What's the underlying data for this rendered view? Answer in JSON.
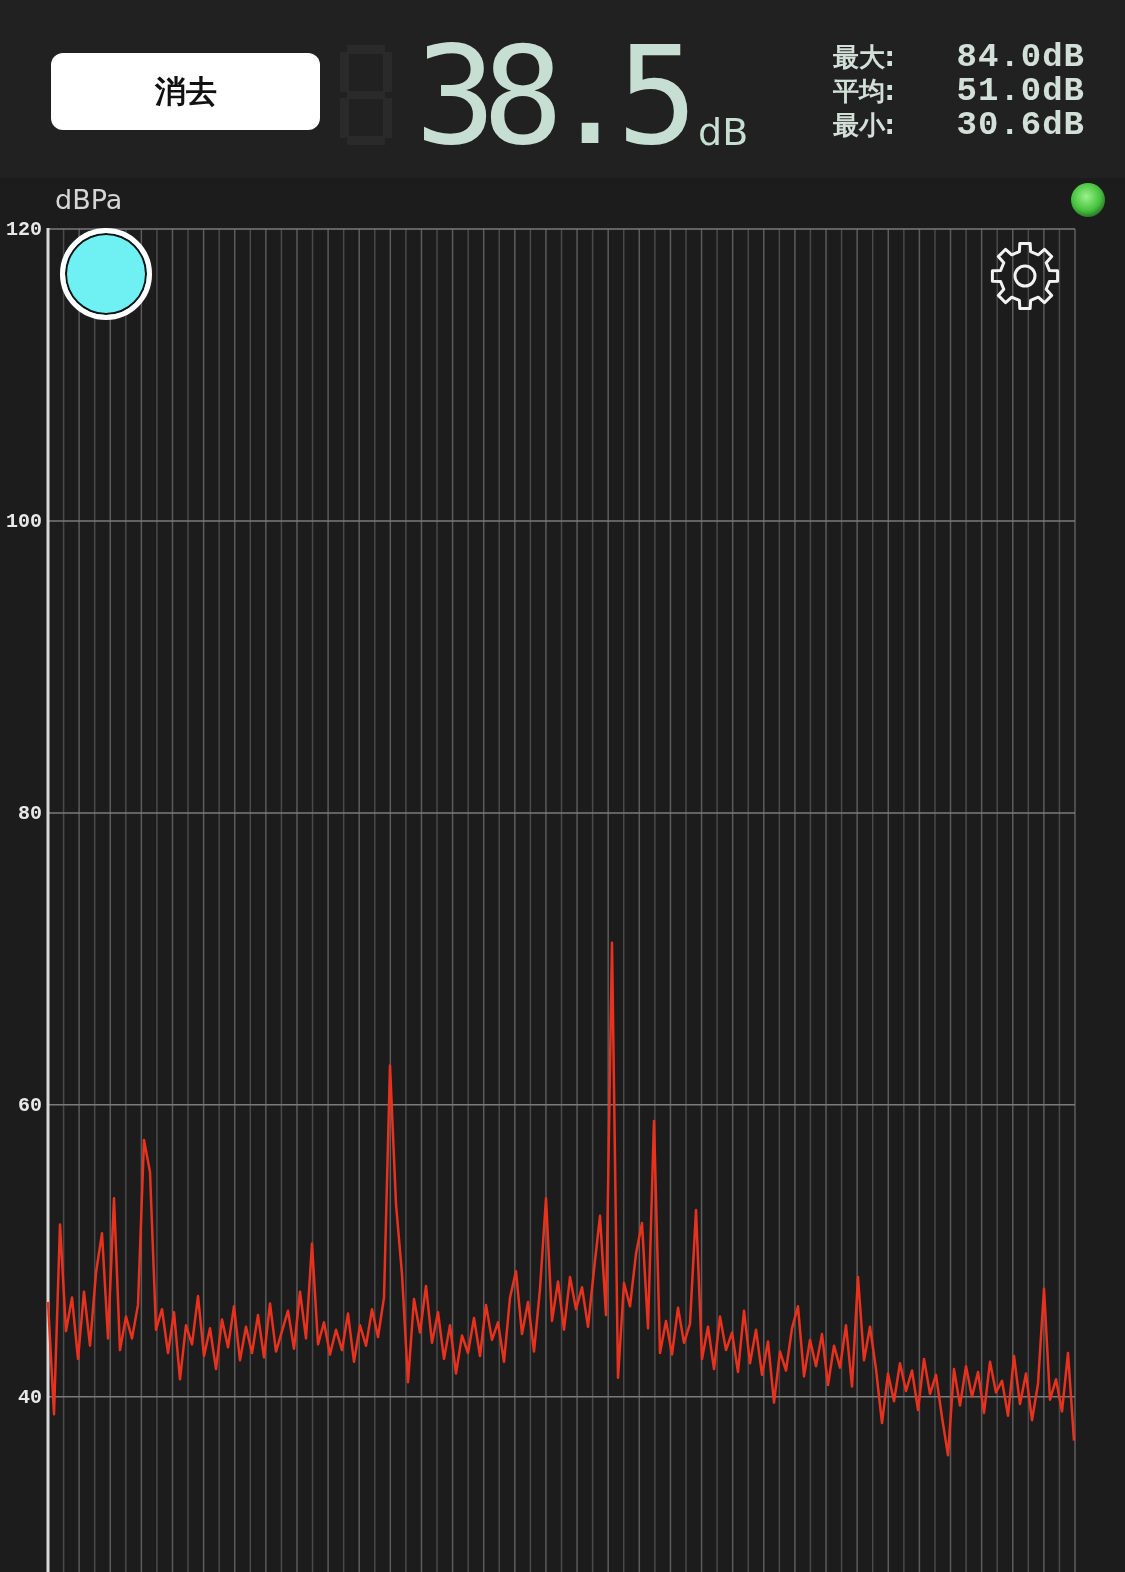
{
  "header": {
    "clear_button": "消去",
    "reading": "38.5",
    "reading_unit": "dB",
    "stats": [
      {
        "label": "最大:",
        "value": "84.0dB"
      },
      {
        "label": "平均:",
        "value": "51.0dB"
      },
      {
        "label": "最小:",
        "value": "30.6dB"
      }
    ]
  },
  "chart": {
    "chart_data": {
      "type": "line",
      "ylabel": "dBPa",
      "ylim": [
        28,
        120
      ],
      "yticks": [
        40,
        60,
        80,
        100,
        120
      ],
      "grid": true,
      "series": [
        {
          "color": "#e8321e",
          "values": [
            46.5,
            38.8,
            51.8,
            44.5,
            46.8,
            42.6,
            47.2,
            43.5,
            48.5,
            51.2,
            44.0,
            53.6,
            43.2,
            45.5,
            44.0,
            46.3,
            57.6,
            55.4,
            44.6,
            46.0,
            43.0,
            45.8,
            41.2,
            44.9,
            43.6,
            46.9,
            42.8,
            44.7,
            41.9,
            45.3,
            43.4,
            46.2,
            42.5,
            44.8,
            43.0,
            45.6,
            42.7,
            46.4,
            43.1,
            44.5,
            45.9,
            43.3,
            47.2,
            44.0,
            50.5,
            43.6,
            45.1,
            42.9,
            44.6,
            43.2,
            45.7,
            42.4,
            44.9,
            43.5,
            46.0,
            44.1,
            46.8,
            62.7,
            53.2,
            48.4,
            41.0,
            46.7,
            44.4,
            47.6,
            43.7,
            45.8,
            42.6,
            44.9,
            41.6,
            44.2,
            43.0,
            45.4,
            42.8,
            46.3,
            43.9,
            45.1,
            42.4,
            46.8,
            48.6,
            44.3,
            46.5,
            43.1,
            47.4,
            53.6,
            45.2,
            47.9,
            44.6,
            48.2,
            46.0,
            47.5,
            44.8,
            48.7,
            52.4,
            45.6,
            71.1,
            41.3,
            47.8,
            46.2,
            49.8,
            51.9,
            44.7,
            58.9,
            43.0,
            45.2,
            42.9,
            46.1,
            43.7,
            45.0,
            52.8,
            42.6,
            44.8,
            41.9,
            45.5,
            43.2,
            44.4,
            41.7,
            45.9,
            42.3,
            44.6,
            41.5,
            43.8,
            39.6,
            43.1,
            41.8,
            44.7,
            46.2,
            41.4,
            43.9,
            42.1,
            44.3,
            40.8,
            43.5,
            42.0,
            44.9,
            40.7,
            48.2,
            42.5,
            44.8,
            41.9,
            38.2,
            41.6,
            39.7,
            42.3,
            40.4,
            41.8,
            39.1,
            42.6,
            40.2,
            41.5,
            38.6,
            36.0,
            41.9,
            39.4,
            42.1,
            40.0,
            41.7,
            38.9,
            42.4,
            40.3,
            41.1,
            38.7,
            42.8,
            39.5,
            41.6,
            38.4,
            40.9,
            47.4,
            39.8,
            41.2,
            39.0,
            43.0,
            37.0
          ]
        }
      ]
    }
  }
}
